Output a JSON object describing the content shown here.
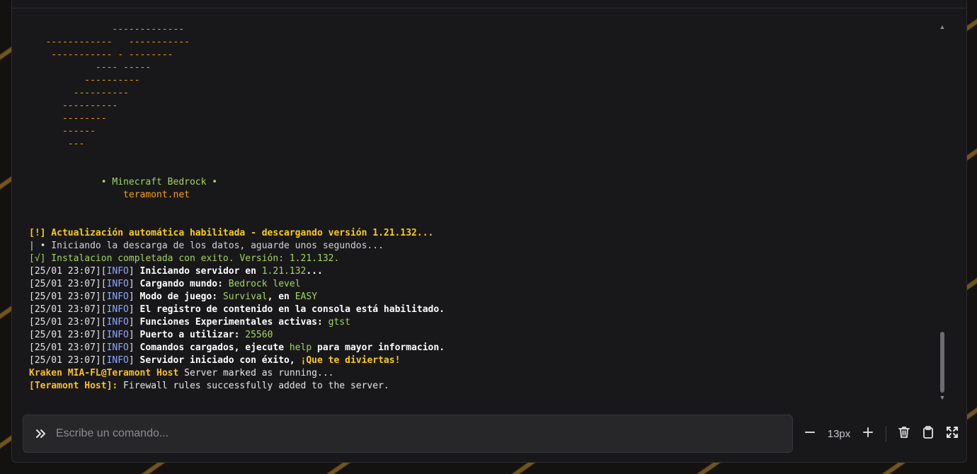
{
  "console_lines": [
    {
      "segments": [
        {
          "t": "               -------------",
          "c": "orange"
        }
      ]
    },
    {
      "segments": [
        {
          "t": "   ------------   -----------",
          "c": "orange"
        }
      ]
    },
    {
      "segments": [
        {
          "t": "    ----------- - --------",
          "c": "orange"
        }
      ]
    },
    {
      "segments": [
        {
          "t": "            ---- -----",
          "c": "orange"
        }
      ]
    },
    {
      "segments": [
        {
          "t": "          ----------",
          "c": "orange"
        }
      ]
    },
    {
      "segments": [
        {
          "t": "        ----------",
          "c": "orange"
        }
      ]
    },
    {
      "segments": [
        {
          "t": "      ----------",
          "c": "orange"
        }
      ]
    },
    {
      "segments": [
        {
          "t": "      --------",
          "c": "orange"
        }
      ]
    },
    {
      "segments": [
        {
          "t": "      ------",
          "c": "orange"
        }
      ]
    },
    {
      "segments": [
        {
          "t": "       ---",
          "c": "orange"
        }
      ]
    },
    {
      "segments": []
    },
    {
      "segments": []
    },
    {
      "segments": [
        {
          "t": "             • Minecraft Bedrock •",
          "c": "green"
        }
      ]
    },
    {
      "segments": [
        {
          "t": "                 teramont.net",
          "c": "orange"
        }
      ]
    },
    {
      "segments": []
    },
    {
      "segments": []
    },
    {
      "segments": [
        {
          "t": "[!] Actualización automática habilitada - descargando versión 1.21.132...",
          "c": "yellow bold-y"
        }
      ]
    },
    {
      "segments": [
        {
          "t": "| • Iniciando la descarga de los datos, aguarde unos segundos...",
          "c": "gray"
        }
      ]
    },
    {
      "segments": [
        {
          "t": "[√] Instalacion completada con exito. Versión: 1.21.132.",
          "c": "green"
        }
      ]
    },
    {
      "segments": [
        {
          "t": "[25/01 23:07][",
          "c": ""
        },
        {
          "t": "INFO",
          "c": "blue"
        },
        {
          "t": "] ",
          "c": ""
        },
        {
          "t": "Iniciando servidor en ",
          "c": "bold"
        },
        {
          "t": "1.21.132",
          "c": "green"
        },
        {
          "t": "...",
          "c": "bold"
        }
      ]
    },
    {
      "segments": [
        {
          "t": "[25/01 23:07][",
          "c": ""
        },
        {
          "t": "INFO",
          "c": "blue"
        },
        {
          "t": "] ",
          "c": ""
        },
        {
          "t": "Cargando mundo: ",
          "c": "bold"
        },
        {
          "t": "Bedrock level",
          "c": "green"
        }
      ]
    },
    {
      "segments": [
        {
          "t": "[25/01 23:07][",
          "c": ""
        },
        {
          "t": "INFO",
          "c": "blue"
        },
        {
          "t": "] ",
          "c": ""
        },
        {
          "t": "Modo de juego: ",
          "c": "bold"
        },
        {
          "t": "Survival",
          "c": "green"
        },
        {
          "t": ", en ",
          "c": "bold"
        },
        {
          "t": "EASY",
          "c": "green"
        }
      ]
    },
    {
      "segments": [
        {
          "t": "[25/01 23:07][",
          "c": ""
        },
        {
          "t": "INFO",
          "c": "blue"
        },
        {
          "t": "] ",
          "c": ""
        },
        {
          "t": "El registro de contenido en la consola está habilitado.",
          "c": "bold"
        }
      ]
    },
    {
      "segments": [
        {
          "t": "[25/01 23:07][",
          "c": ""
        },
        {
          "t": "INFO",
          "c": "blue"
        },
        {
          "t": "] ",
          "c": ""
        },
        {
          "t": "Funciones Experimentales activas: ",
          "c": "bold"
        },
        {
          "t": "gtst",
          "c": "green"
        }
      ]
    },
    {
      "segments": [
        {
          "t": "[25/01 23:07][",
          "c": ""
        },
        {
          "t": "INFO",
          "c": "blue"
        },
        {
          "t": "] ",
          "c": ""
        },
        {
          "t": "Puerto a utilizar: ",
          "c": "bold"
        },
        {
          "t": "25560",
          "c": "green"
        }
      ]
    },
    {
      "segments": [
        {
          "t": "[25/01 23:07][",
          "c": ""
        },
        {
          "t": "INFO",
          "c": "blue"
        },
        {
          "t": "] ",
          "c": ""
        },
        {
          "t": "Comandos cargados, ejecute ",
          "c": "bold"
        },
        {
          "t": "help",
          "c": "green"
        },
        {
          "t": " para mayor informacion.",
          "c": "bold"
        }
      ]
    },
    {
      "segments": [
        {
          "t": "[25/01 23:07][",
          "c": ""
        },
        {
          "t": "INFO",
          "c": "blue"
        },
        {
          "t": "] ",
          "c": ""
        },
        {
          "t": "Servidor iniciado con éxito, ",
          "c": "bold"
        },
        {
          "t": "¡Que te diviertas!",
          "c": "yellow bold-y"
        }
      ]
    },
    {
      "segments": [
        {
          "t": "Kraken MIA-FL@Teramont Host",
          "c": "host"
        },
        {
          "t": " Server marked as running...",
          "c": ""
        }
      ]
    },
    {
      "segments": [
        {
          "t": "[Teramont Host]:",
          "c": "host"
        },
        {
          "t": " Firewall rules successfully added to the server.",
          "c": ""
        }
      ]
    }
  ],
  "command": {
    "placeholder": "Escribe un comando...",
    "value": ""
  },
  "toolbar": {
    "font_size": "13px"
  },
  "icons": {
    "prompt": "chevrons-right-icon",
    "decrease": "minus-icon",
    "increase": "plus-icon",
    "clear": "trash-icon",
    "copy": "clipboard-icon",
    "fullscreen": "maximize-icon"
  },
  "colors": {
    "accent_orange": "#f59e0b",
    "info_blue": "#8ea6ff",
    "value_green": "#a3d65c",
    "warn_yellow": "#facc15"
  }
}
